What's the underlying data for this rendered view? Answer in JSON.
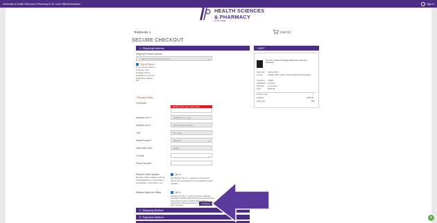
{
  "topbar": {
    "text": "University of Health Sciences & Pharmacy in St. Louis Official Bookstore",
    "signin": "Sign in"
  },
  "logo": {
    "line1": "UNIVERSITY OF",
    "line2a": "HEALTH SCIENCES",
    "line2b": "& PHARMACY",
    "line3": "in St. Louis"
  },
  "nav": {
    "textbooks": "Textbooks ∨"
  },
  "cart": {
    "label": "Cart (1)"
  },
  "page": {
    "title": "SECURE CHECKOUT"
  },
  "sections": {
    "shipping_address": "1. Shipping Address",
    "shipping_method": "2. Shipping Method",
    "payment_method": "3. Payment Method"
  },
  "form": {
    "prev_address_label": "Shipping Previous Address",
    "prev_address_value": "-- Select to Use Previous Address --",
    "ship_to_school": "Ship to School",
    "ship_note": "If you choose Ship to Campus, your package will be available for pick up beginning January 3rd.",
    "required_note": "* Required Fields",
    "full_name_label": "Full Name*",
    "full_name_error": "Please enter your name here.",
    "address1_label": "Address Line 1*",
    "address1_value": "UHSP St. St. Louis",
    "address2_label": "Address Line 2",
    "address2_value": "4615 Childrens Place",
    "city_label": "City*",
    "city_value": "St. Louis",
    "state_label": "State/Province*",
    "state_value": "Missouri",
    "zip_label": "Zip/Postal Code*",
    "zip_value": "63110",
    "country_label": "Country*",
    "country_value": "",
    "phone_label": "Phone Number*",
    "receive_updates_label": "Receive Order Updates",
    "receive_updates_desc": "Receive order updates such as shipping/delivery confirmation, cancellation, information, etc.",
    "optin1": "Opt In",
    "optin1_text": "By clicking \"Opt In\", I agree to receive text phone text messages from us regarding order updates.",
    "receive_news_label": "Receive News and Offers",
    "optin2": "Opt In",
    "optin2_text": "By selecting \"Opt In\", I agree to receive marketing messages, including discounts and promotional events, at the phone number provided. Reply STOP to unsubscribe. Message frequency varies. Msg and data rates may apply.",
    "continue": "Continue"
  },
  "cart_panel": {
    "header": "CART",
    "book_title": "The Art of Public Speaking (Revised) Loose-leaf w/Access",
    "rows": [
      [
        "Semester",
        "Spring 2022"
      ],
      [
        "Course",
        "COMM 1140 / 1150 A Intermediate 1120 Speaking"
      ],
      [
        "Condition",
        "USED"
      ],
      [
        "Availability",
        "In stock"
      ],
      [
        "Quantity",
        "1 (remove)"
      ],
      [
        "Price",
        "$100.96"
      ]
    ],
    "items_label": "Items in Cart",
    "items_value": "1",
    "subtotal_label": "Subtotal",
    "subtotal_value": "$100.96",
    "tax_label": "Sales Tax",
    "tax_value": "TBD"
  },
  "colors": {
    "brand": "#4b2e83",
    "error": "#e8141d",
    "checkbox": "#2f6fdb",
    "chat": "#6aa84f"
  },
  "icons": [
    "user-circle-icon",
    "cart-icon",
    "chevron-down-icon",
    "arrow-icon",
    "chat-icon"
  ]
}
